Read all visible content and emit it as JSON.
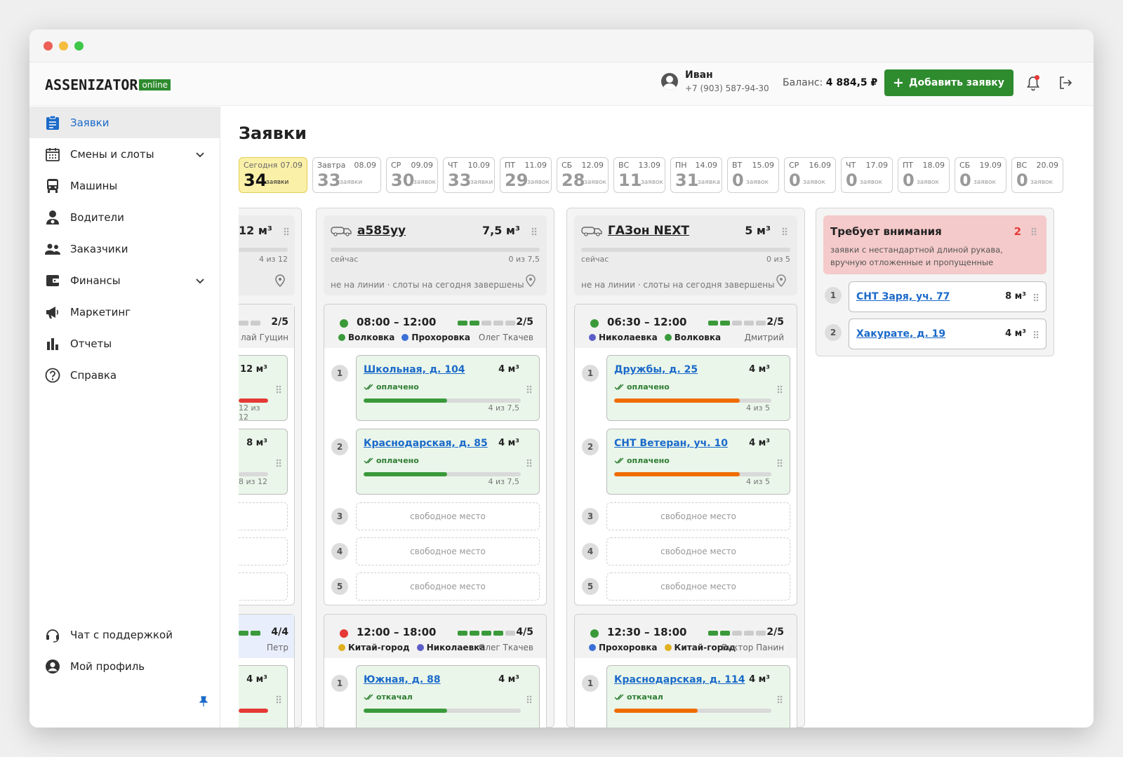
{
  "header": {
    "logo_main": "ASSENIZATOR",
    "logo_tag": "online",
    "user_name": "Иван",
    "user_phone": "+7 (903) 587-94-30",
    "balance_label": "Баланс:",
    "balance_value": "4 884,5 ₽",
    "add_label": "Добавить заявку"
  },
  "sidebar": {
    "items": [
      {
        "label": "Заявки",
        "icon": "clipboard-icon",
        "active": true
      },
      {
        "label": "Смены и слоты",
        "icon": "calendar-icon",
        "expand": true
      },
      {
        "label": "Машины",
        "icon": "bus-icon"
      },
      {
        "label": "Водители",
        "icon": "driver-icon"
      },
      {
        "label": "Заказчики",
        "icon": "people-icon"
      },
      {
        "label": "Финансы",
        "icon": "wallet-icon",
        "expand": true
      },
      {
        "label": "Маркетинг",
        "icon": "megaphone-icon"
      },
      {
        "label": "Отчеты",
        "icon": "bar-chart-icon"
      },
      {
        "label": "Справка",
        "icon": "help-icon"
      }
    ],
    "bottom": [
      {
        "label": "Чат с поддержкой",
        "icon": "headset-icon"
      },
      {
        "label": "Мой профиль",
        "icon": "profile-icon"
      }
    ]
  },
  "page": {
    "title": "Заявки"
  },
  "days": [
    {
      "name": "Сегодня",
      "date": "07.09",
      "count": "34",
      "unit": "заявки"
    },
    {
      "name": "Завтра",
      "date": "08.09",
      "count": "33",
      "unit": "заявки"
    },
    {
      "name": "СР",
      "date": "09.09",
      "count": "30",
      "unit": "заявок"
    },
    {
      "name": "ЧТ",
      "date": "10.09",
      "count": "33",
      "unit": "заявки"
    },
    {
      "name": "ПТ",
      "date": "11.09",
      "count": "29",
      "unit": "заявок"
    },
    {
      "name": "СБ",
      "date": "12.09",
      "count": "28",
      "unit": "заявок"
    },
    {
      "name": "ВС",
      "date": "13.09",
      "count": "11",
      "unit": "заявок"
    },
    {
      "name": "ПН",
      "date": "14.09",
      "count": "31",
      "unit": "заявка"
    },
    {
      "name": "ВТ",
      "date": "15.09",
      "count": "0",
      "unit": "заявок"
    },
    {
      "name": "СР",
      "date": "16.09",
      "count": "0",
      "unit": "заявок"
    },
    {
      "name": "ЧТ",
      "date": "17.09",
      "count": "0",
      "unit": "заявок"
    },
    {
      "name": "ПТ",
      "date": "18.09",
      "count": "0",
      "unit": "заявок"
    },
    {
      "name": "СБ",
      "date": "19.09",
      "count": "0",
      "unit": "заявок"
    },
    {
      "name": "ВС",
      "date": "20.09",
      "count": "0",
      "unit": "заявок"
    }
  ],
  "partial": {
    "vol": "12 м³",
    "cap": "4 из 12",
    "shift_count": "2/5",
    "driver": "лай Гущин",
    "o1_vol": "12 м³",
    "o1_cap": "12 из 12",
    "o2_vol": "8 м³",
    "o2_cap": "8 из 12",
    "s2_count": "4/4",
    "s2_driver": "Петр",
    "o3_vol": "4 м³"
  },
  "trucks": [
    {
      "name": "а585уу",
      "vol": "7,5 м³",
      "now": "сейчас",
      "load": "0 из 7,5",
      "state": "не на линии · слоты на сегодня завершены",
      "s1": {
        "time": "08:00 – 12:00",
        "count": "2/5",
        "filled": 2,
        "status_color": "#3a9a3a",
        "a1": "Волковка",
        "a1c": "#3a9a3a",
        "a2": "Прохоровка",
        "a2c": "#3b6fd6",
        "driver": "Олег Ткачев"
      },
      "orders": [
        {
          "addr": "Школьная, д. 104",
          "vol": "4 м³",
          "status": "оплачено",
          "cap": "4 из 7,5",
          "pct": 0.53,
          "color": "#3a9a3a"
        },
        {
          "addr": "Краснодарская, д. 85",
          "vol": "4 м³",
          "status": "оплачено",
          "cap": "4 из 7,5",
          "pct": 0.53,
          "color": "#3a9a3a"
        }
      ],
      "s2": {
        "time": "12:00 – 18:00",
        "count": "4/5",
        "filled": 4,
        "status_color": "#e53935",
        "a1": "Китай-город",
        "a1c": "#e0b020",
        "a2": "Николаевка",
        "a2c": "#5d5dc8",
        "driver": "Олег Ткачев"
      },
      "order3": {
        "addr": "Южная, д. 88",
        "vol": "4 м³",
        "status": "откачал",
        "color": "#3a9a3a"
      }
    },
    {
      "name": "ГАЗон NEXT",
      "vol": "5 м³",
      "now": "сейчас",
      "load": "0 из 5",
      "state": "не на линии · слоты на сегодня завершены",
      "s1": {
        "time": "06:30 – 12:00",
        "count": "2/5",
        "filled": 2,
        "status_color": "#3a9a3a",
        "a1": "Николаевка",
        "a1c": "#5d5dc8",
        "a2": "Волковка",
        "a2c": "#3a9a3a",
        "driver": "Дмитрий"
      },
      "orders": [
        {
          "addr": "Дружбы, д. 25",
          "vol": "4 м³",
          "status": "оплачено",
          "cap": "4 из 5",
          "pct": 0.8,
          "color": "#ef6c00"
        },
        {
          "addr": "СНТ Ветеран, уч. 10",
          "vol": "4 м³",
          "status": "оплачено",
          "cap": "4 из 5",
          "pct": 0.8,
          "color": "#ef6c00"
        }
      ],
      "s2": {
        "time": "12:30 – 18:00",
        "count": "2/5",
        "filled": 2,
        "status_color": "#3a9a3a",
        "a1": "Прохоровка",
        "a1c": "#3b6fd6",
        "a2": "Китай-город",
        "a2c": "#e0b020",
        "driver": "Виктор Панин"
      },
      "order3": {
        "addr": "Краснодарская, д. 114",
        "vol": "4 м³",
        "status": "откачал",
        "color": "#ef6c00"
      }
    }
  ],
  "free_label": "свободное место",
  "attention": {
    "title": "Требует внимания",
    "count": "2",
    "desc": "заявки с нестандартной длиной рукава, вручную отложенные и пропущенные",
    "items": [
      {
        "num": "1",
        "addr": "СНТ Заря, уч. 77",
        "vol": "8 м³"
      },
      {
        "num": "2",
        "addr": "Хакурате, д. 19",
        "vol": "4 м³"
      }
    ]
  }
}
